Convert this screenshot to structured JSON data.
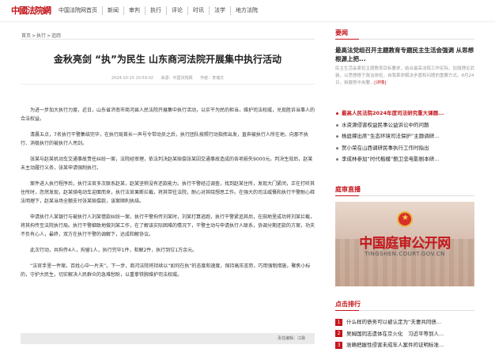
{
  "site": {
    "logo_text": "中國法院網"
  },
  "nav": [
    "中国法院网首页",
    "新闻",
    "审判",
    "执行",
    "评论",
    "时讯",
    "法学",
    "地方法院"
  ],
  "breadcrumb": [
    "首页",
    "执行",
    "追踪"
  ],
  "article": {
    "title": "金秋亮剑 “执”为民生 山东商河法院开展集中执行活动",
    "date": "2024-10-15 10:59:02",
    "source": "来源：中国法院网",
    "author": "作者：李瑞文",
    "paragraphs": [
      "为进一步加大执行力度，近日，山东省济南市商河县人民法院开展集中执行活动，以实干为民的担当，维护司法权威，兑现胜诉当事人的合法权益。",
      "清晨五点，7名执行干警集结完毕，在执行局首长一声号令带动员之后，执行团队按照行动指挥出发，直奔被执行人所在地，向那不执行、消极执行的被执行人亮剑。",
      "张某与赵某机动车交通事故责任纠纷一案，法院经审理，依法判决赵某赔偿张某因交通事故造成的各项损失9000元。判决生效后，赵某未主动履行义务，张某申请强制执行。",
      "案件进入执行程序后，执行法官多次联系赵某，赵某坚称没有还款能力。执行干警经过调查，找到赵某住所，发现大门紧闭，正在打听其住所时，忽然发现，赵某骑电动车迎面而来，执行法官果断拦截，将其带往法院，耐心对其晓想思工作。在强大的司法威慑和执行干警耐心释法明理下，赵某当场全额支付张某赔偿款，该案顺利执结。",
      "申请执行人某银行与被执行人刘某借款纠纷一案，执行干警拘传刘某时，刘某打算逃跑，执行干警紧追其后，在田地里成功将刘某拦截，将其拘传至法院执行局。执行干警细致地做刘某工作，在了解该实际困难的情况下，干警主动与申请执行人联系，协调分期还款的方案，功夫不负有心人，最终，双方在执行干警的调解下，达成和解协议。",
      "此次行动，共拘传4人，拘留1人，执行完毕1件，和解2件，执行到位1万余元。",
      "“法官手里一件案，百姓心中一片天”。下一步，商河法院将持续以“如何在执”的态度和速度，保持高压态势，巧用强制措施，聚焦小标的，守护大民生，切实解决人民群众的急难愁盼，以重拳铁腕维护司法权威。"
    ],
    "editor": "责任编辑：江霖"
  },
  "sidebar": {
    "yaowen_heading": "要闻",
    "yaowen_title": "最高法党组召开主题教育专题民主生活会强调 从思想根源上把...",
    "yaowen_summary": "民主生活会紧扣主题教育目标要求，结合最高法院工作实际，加强理论武装，以思想根子政治体检，自我革命解决矛盾和问题的重要方式。8月24日，拍摄常中央要...",
    "yaowen_more": "[详情]",
    "news": [
      "最高人民法院2024年度司法研究重大课题...",
      "水资源侵害权益民事公益诉讼中的问题",
      "杨庭撑出席“生态环境司法保护”主题调研...",
      "贺小荣在山西调研民事执行工作时指出",
      "李成林参加“时代楷模”鲍卫忠电影剧本研..."
    ],
    "tingshen_heading": "庭审直播",
    "tingshen_brand": "中国庭审公开网",
    "tingshen_url": "TINGSHEN.COURT.GOV.CN",
    "rank_heading": "点击排行",
    "rank": [
      {
        "n": "1",
        "t": "什么样的债务可以被认定为“夫妻共同债..."
      },
      {
        "n": "2",
        "t": "吴姆国同志遗体在京火化　习近平等到人..."
      },
      {
        "n": "3",
        "t": "准确把握性侵害未成年人案件的证明标准..."
      }
    ]
  }
}
